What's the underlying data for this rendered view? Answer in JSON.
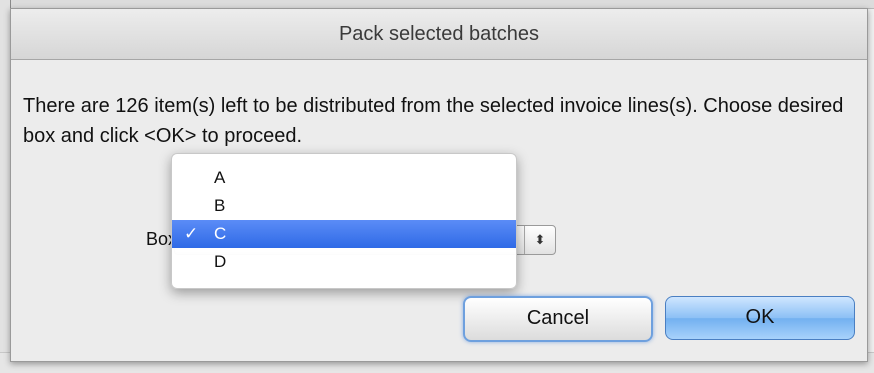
{
  "dialog": {
    "title": "Pack selected batches",
    "message": "There are 126 item(s) left to be distributed from the selected invoice lines(s). Choose desired box and click <OK> to proceed."
  },
  "box_selector": {
    "label": "Box:",
    "stepper_glyph": "⬍",
    "options": [
      {
        "label": "A",
        "check": ""
      },
      {
        "label": "B",
        "check": ""
      },
      {
        "label": "C",
        "check": "✓"
      },
      {
        "label": "D",
        "check": ""
      }
    ],
    "selected": "C"
  },
  "buttons": {
    "cancel": "Cancel",
    "ok": "OK"
  },
  "colors": {
    "selection": "#3c74ea",
    "ok_button": "#8cc0f5",
    "focus_ring": "#6ea0de"
  }
}
